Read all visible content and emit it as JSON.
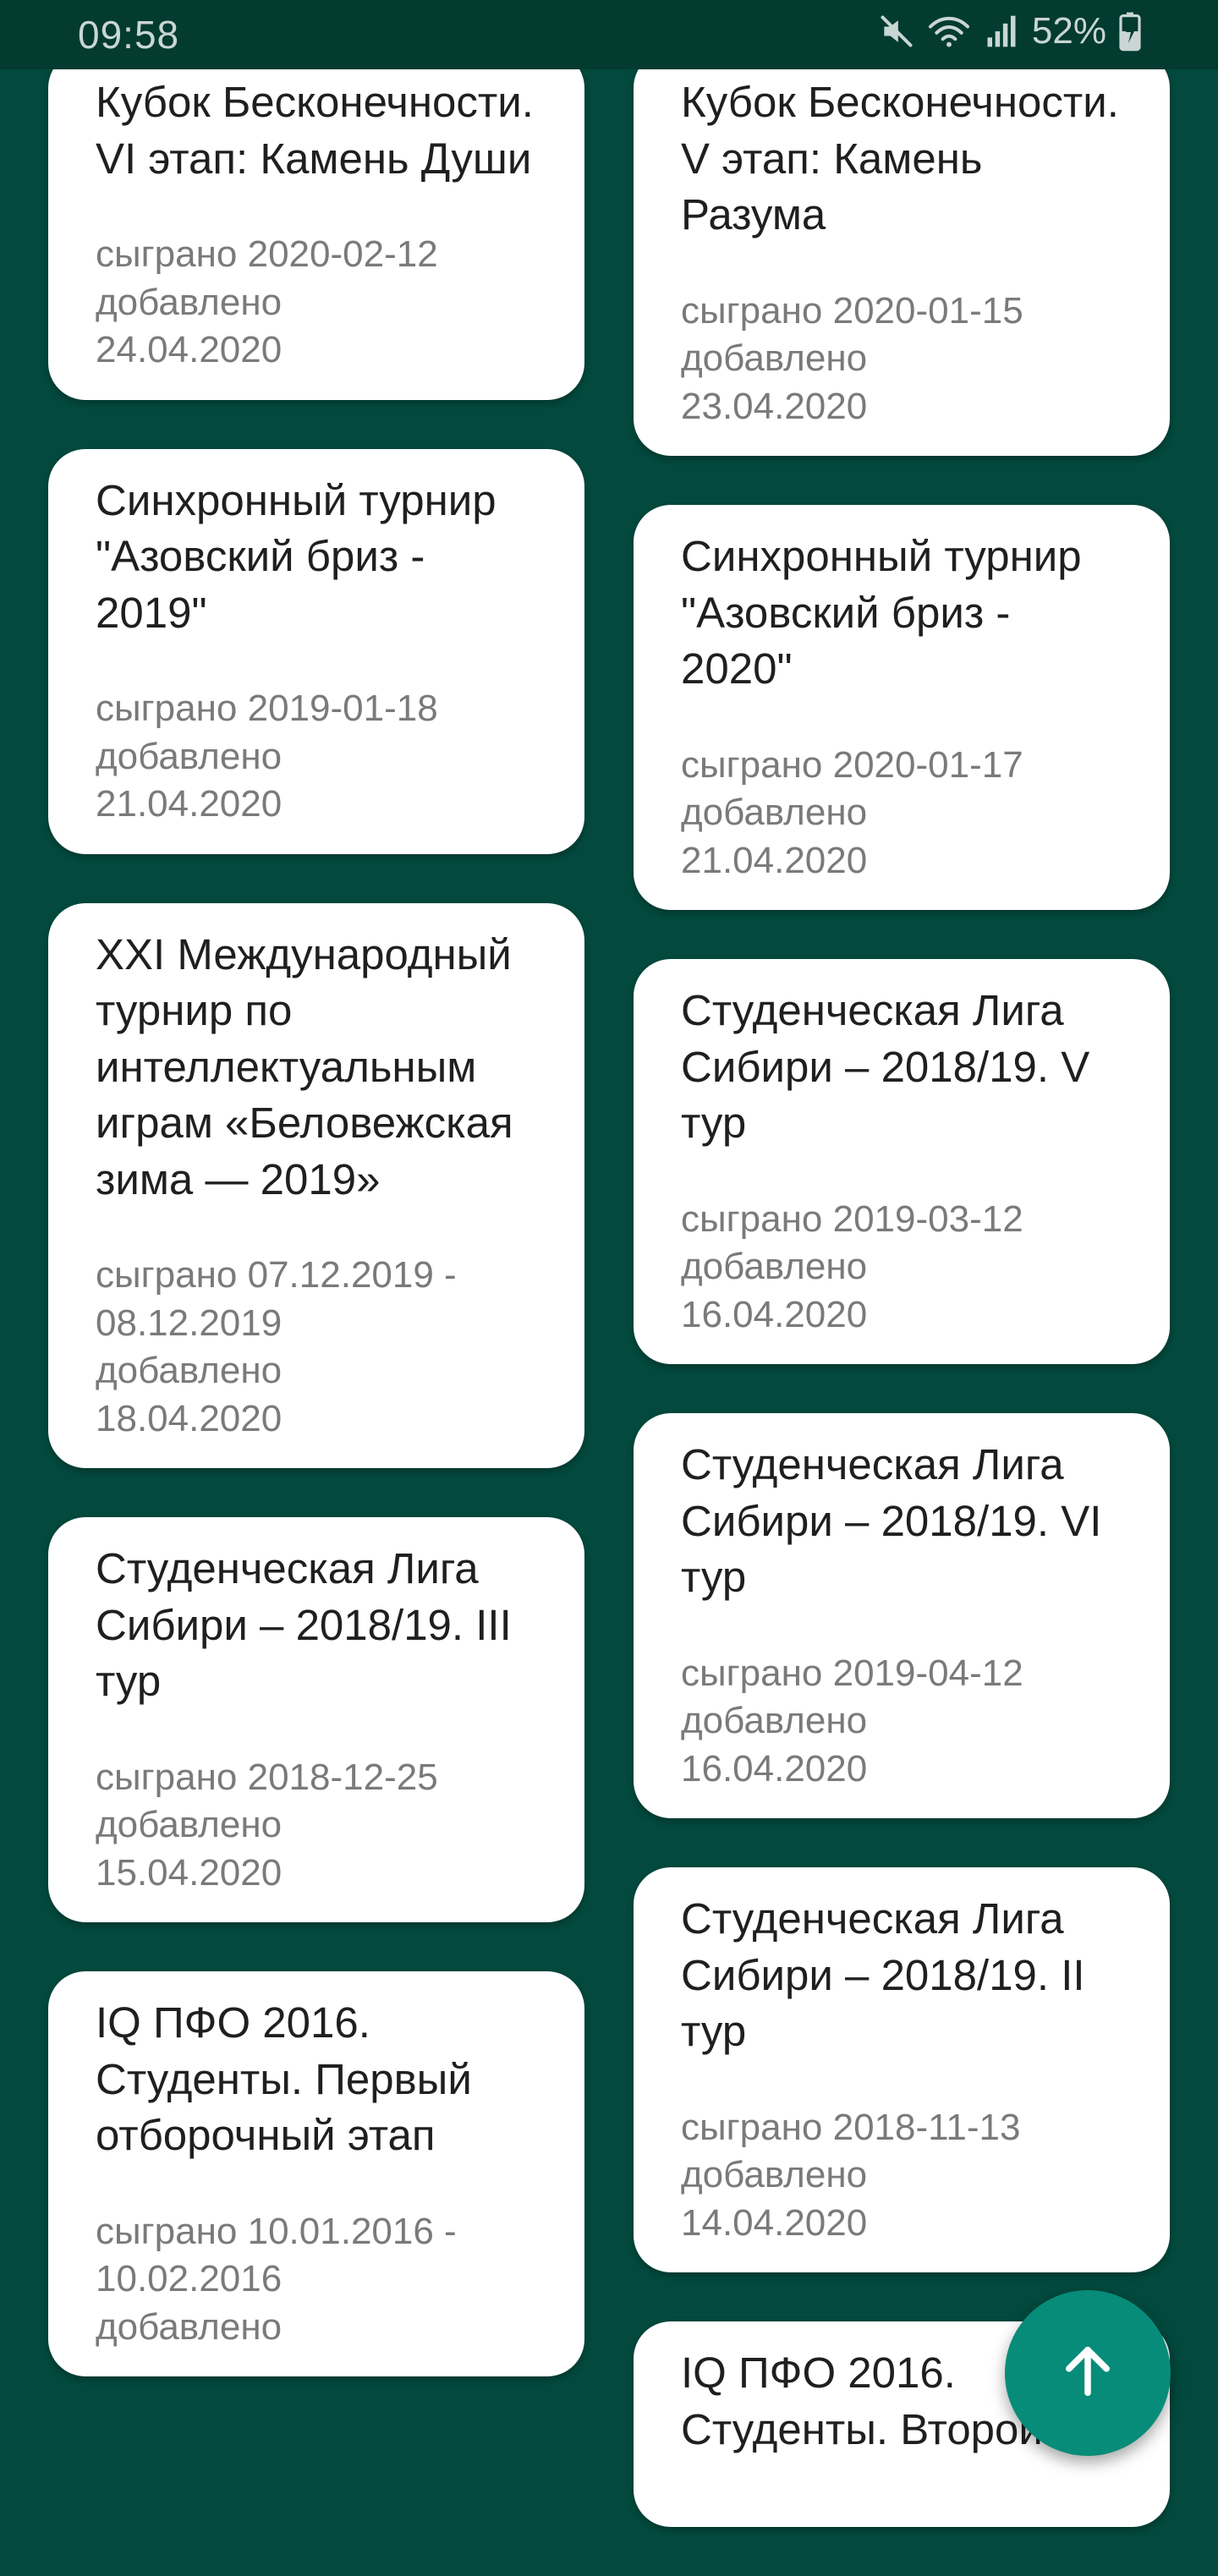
{
  "status_bar": {
    "time": "09:58",
    "battery": "52%",
    "icons": [
      "mute-icon",
      "wifi-icon",
      "signal-icon",
      "battery-icon"
    ]
  },
  "colors": {
    "background": "#03493d",
    "card": "#ffffff",
    "fab": "#078c79"
  },
  "left_column": [
    {
      "title": "Кубок Бесконечности. VI этап: Камень Души",
      "played": "сыграно 2020-02-12",
      "added_label": "добавлено",
      "added_date": "24.04.2020"
    },
    {
      "title": "Синхронный турнир \"Азовский бриз - 2019\"",
      "played": "сыграно 2019-01-18",
      "added_label": "добавлено",
      "added_date": "21.04.2020"
    },
    {
      "title": "XXI Международный турнир по интеллектуальным играм «Беловежская зима — 2019»",
      "played": "сыграно 07.12.2019 - 08.12.2019",
      "added_label": "добавлено",
      "added_date": "18.04.2020"
    },
    {
      "title": "Студенческая Лига Сибири – 2018/19. III тур",
      "played": "сыграно 2018-12-25",
      "added_label": "добавлено",
      "added_date": "15.04.2020"
    },
    {
      "title": "IQ ПФО 2016. Студенты. Первый отборочный этап",
      "played": "сыграно 10.01.2016 - 10.02.2016",
      "added_label": "добавлено",
      "added_date": ""
    }
  ],
  "right_column": [
    {
      "title": "Кубок Бесконечности. V этап: Камень Разума",
      "played": "сыграно 2020-01-15",
      "added_label": "добавлено",
      "added_date": "23.04.2020"
    },
    {
      "title": "Синхронный турнир \"Азовский бриз - 2020\"",
      "played": "сыграно 2020-01-17",
      "added_label": "добавлено",
      "added_date": "21.04.2020"
    },
    {
      "title": "Студенческая Лига Сибири – 2018/19. V тур",
      "played": "сыграно 2019-03-12",
      "added_label": "добавлено",
      "added_date": "16.04.2020"
    },
    {
      "title": "Студенческая Лига Сибири – 2018/19. VI тур",
      "played": "сыграно 2019-04-12",
      "added_label": "добавлено",
      "added_date": "16.04.2020"
    },
    {
      "title": "Студенческая Лига Сибири – 2018/19. II тур",
      "played": "сыграно 2018-11-13",
      "added_label": "добавлено",
      "added_date": "14.04.2020"
    },
    {
      "title": "IQ ПФО 2016. Студенты. Второй",
      "played": "",
      "added_label": "",
      "added_date": ""
    }
  ],
  "fab": {
    "icon": "arrow-up-icon",
    "action": "scroll-to-top"
  }
}
